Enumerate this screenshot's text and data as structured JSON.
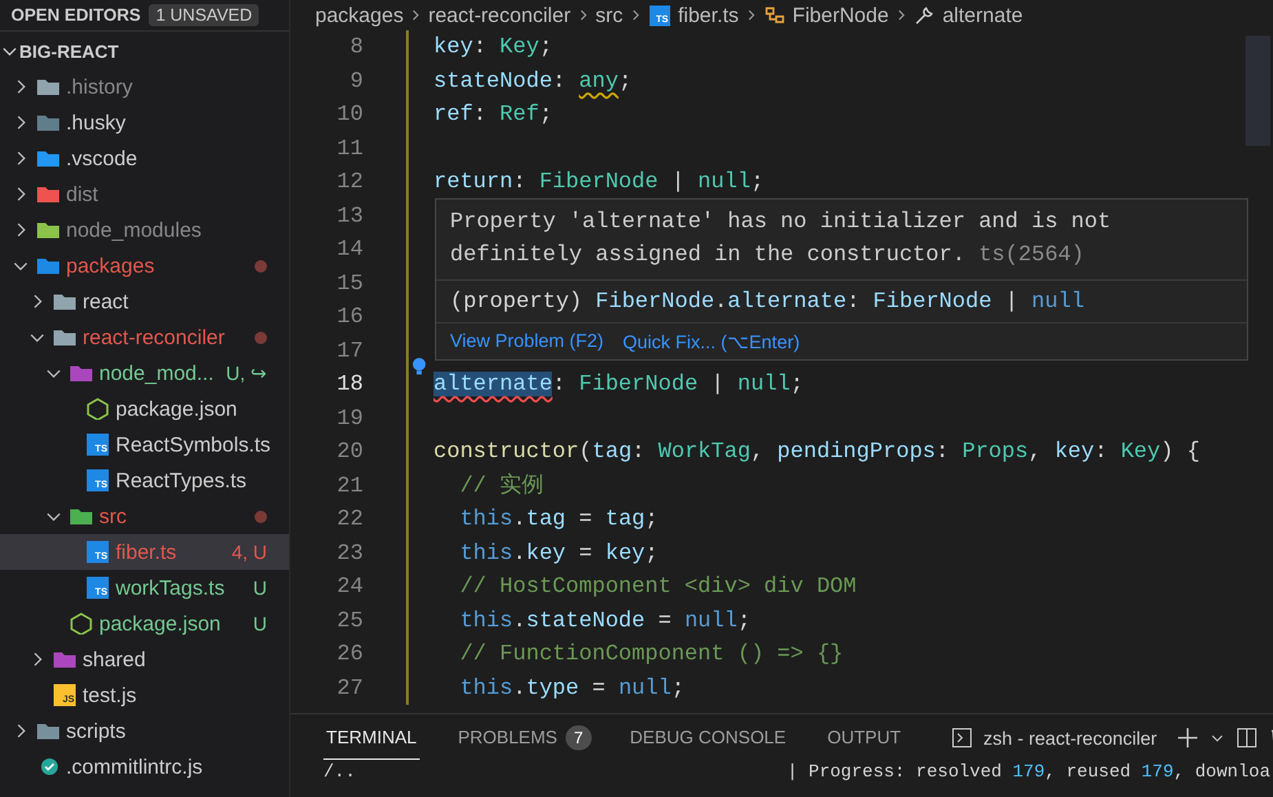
{
  "sidebar": {
    "open_editors": "OPEN EDITORS",
    "unsaved_badge": "1 UNSAVED",
    "project": "BIG-REACT",
    "tree": [
      {
        "name": ".history",
        "kind": "folder",
        "color": "#90a4ae",
        "dimmed": true,
        "modified": false,
        "untracked": false,
        "expanded": false,
        "selected": false
      },
      {
        "name": ".husky",
        "kind": "folder",
        "color": "#607d8b",
        "dimmed": false,
        "modified": false,
        "untracked": false,
        "expanded": false,
        "selected": false
      },
      {
        "name": ".vscode",
        "kind": "folder",
        "color": "#2196f3",
        "dimmed": false,
        "modified": false,
        "untracked": false,
        "expanded": false,
        "selected": false
      },
      {
        "name": "dist",
        "kind": "folder",
        "color": "#ef5350",
        "dimmed": true,
        "modified": false,
        "untracked": false,
        "expanded": false,
        "selected": false
      },
      {
        "name": "node_modules",
        "kind": "folder",
        "color": "#8bc34a",
        "dimmed": true,
        "modified": false,
        "untracked": false,
        "expanded": false,
        "selected": false
      },
      {
        "name": "packages",
        "kind": "folder",
        "color": "#1e88e5",
        "dimmed": false,
        "modified": true,
        "untracked": false,
        "expanded": true,
        "selected": false,
        "children": [
          {
            "name": "react",
            "kind": "folder",
            "color": "#90a4ae",
            "dimmed": false,
            "modified": false,
            "untracked": false,
            "expanded": false,
            "selected": false
          },
          {
            "name": "react-reconciler",
            "kind": "folder",
            "color": "#90a4ae",
            "dimmed": false,
            "modified": true,
            "untracked": false,
            "expanded": true,
            "selected": false,
            "children": [
              {
                "name": "node_mod...",
                "kind": "folder",
                "color": "#ab47bc",
                "dimmed": false,
                "modified": false,
                "untracked": true,
                "expanded": true,
                "selected": false,
                "status": "U, ↪",
                "children": [
                  {
                    "name": "package.json",
                    "kind": "json",
                    "dimmed": false,
                    "modified": false,
                    "untracked": false,
                    "selected": false
                  },
                  {
                    "name": "ReactSymbols.ts",
                    "kind": "ts",
                    "icon_text": "TS",
                    "dimmed": false,
                    "modified": false,
                    "untracked": false,
                    "selected": false
                  },
                  {
                    "name": "ReactTypes.ts",
                    "kind": "ts",
                    "icon_text": "TS",
                    "dimmed": false,
                    "modified": false,
                    "untracked": false,
                    "selected": false
                  }
                ]
              },
              {
                "name": "src",
                "kind": "folder",
                "color": "#4caf50",
                "dimmed": false,
                "modified": true,
                "untracked": false,
                "expanded": true,
                "selected": false,
                "children": [
                  {
                    "name": "fiber.ts",
                    "kind": "ts",
                    "icon_text": "TS",
                    "dimmed": false,
                    "modified": true,
                    "untracked": false,
                    "selected": true,
                    "status": "4, U"
                  },
                  {
                    "name": "workTags.ts",
                    "kind": "ts",
                    "icon_text": "TS",
                    "dimmed": false,
                    "modified": false,
                    "untracked": true,
                    "selected": false,
                    "status": "U"
                  }
                ]
              },
              {
                "name": "package.json",
                "kind": "json",
                "dimmed": false,
                "modified": false,
                "untracked": true,
                "selected": false,
                "status": "U"
              }
            ]
          },
          {
            "name": "shared",
            "kind": "folder",
            "color": "#ab47bc",
            "dimmed": false,
            "modified": false,
            "untracked": false,
            "expanded": false,
            "selected": false
          },
          {
            "name": "test.js",
            "kind": "js",
            "icon_text": "JS",
            "dimmed": false,
            "modified": false,
            "untracked": false,
            "selected": false
          }
        ]
      },
      {
        "name": "scripts",
        "kind": "folder",
        "color": "#78909c",
        "dimmed": false,
        "modified": false,
        "untracked": false,
        "expanded": false,
        "selected": false
      },
      {
        "name": ".commitlintrc.js",
        "kind": "config",
        "dimmed": false,
        "modified": false,
        "untracked": false,
        "selected": false
      }
    ]
  },
  "breadcrumb": [
    {
      "label": "packages",
      "kind": "plain"
    },
    {
      "label": "react-reconciler",
      "kind": "plain"
    },
    {
      "label": "src",
      "kind": "plain"
    },
    {
      "label": "fiber.ts",
      "kind": "ts",
      "icon_text": "TS"
    },
    {
      "label": "FiberNode",
      "kind": "class"
    },
    {
      "label": "alternate",
      "kind": "property"
    }
  ],
  "code": [
    {
      "num": "8",
      "current": false,
      "tokens": [
        {
          "text": "key",
          "kind": "prop"
        },
        {
          "text": ": ",
          "kind": "punct"
        },
        {
          "text": "Key",
          "kind": "type"
        },
        {
          "text": ";",
          "kind": "punct"
        }
      ]
    },
    {
      "num": "9",
      "current": false,
      "tokens": [
        {
          "text": "stateNode",
          "kind": "prop"
        },
        {
          "text": ": ",
          "kind": "punct"
        },
        {
          "text": "any",
          "kind": "warning"
        },
        {
          "text": ";",
          "kind": "punct"
        }
      ]
    },
    {
      "num": "10",
      "current": false,
      "tokens": [
        {
          "text": "ref",
          "kind": "prop"
        },
        {
          "text": ": ",
          "kind": "punct"
        },
        {
          "text": "Ref",
          "kind": "type"
        },
        {
          "text": ";",
          "kind": "punct"
        }
      ]
    },
    {
      "num": "11",
      "current": false
    },
    {
      "num": "12",
      "current": false,
      "tokens": [
        {
          "text": "return",
          "kind": "prop"
        },
        {
          "text": ": ",
          "kind": "punct"
        },
        {
          "text": "FiberNode",
          "kind": "type"
        },
        {
          "text": " | ",
          "kind": "punct"
        },
        {
          "text": "null",
          "kind": "type"
        },
        {
          "text": ";",
          "kind": "punct"
        }
      ]
    },
    {
      "num": "13",
      "current": false
    },
    {
      "num": "14",
      "current": false
    },
    {
      "num": "15",
      "current": false
    },
    {
      "num": "16",
      "current": false
    },
    {
      "num": "17",
      "current": false
    },
    {
      "num": "18",
      "current": true,
      "tokens": [
        {
          "text": "alternate",
          "kind": "error"
        },
        {
          "text": ": ",
          "kind": "punct"
        },
        {
          "text": "FiberNode",
          "kind": "type"
        },
        {
          "text": " | ",
          "kind": "punct"
        },
        {
          "text": "null",
          "kind": "type"
        },
        {
          "text": ";",
          "kind": "punct"
        }
      ]
    },
    {
      "num": "19",
      "current": false
    },
    {
      "num": "20",
      "current": false,
      "tokens": [
        {
          "text": "constructor",
          "kind": "func"
        },
        {
          "text": "(",
          "kind": "punct"
        },
        {
          "text": "tag",
          "kind": "prop"
        },
        {
          "text": ": ",
          "kind": "punct"
        },
        {
          "text": "WorkTag",
          "kind": "type"
        },
        {
          "text": ", ",
          "kind": "punct"
        },
        {
          "text": "pendingProps",
          "kind": "prop"
        },
        {
          "text": ": ",
          "kind": "punct"
        },
        {
          "text": "Props",
          "kind": "type"
        },
        {
          "text": ", ",
          "kind": "punct"
        },
        {
          "text": "key",
          "kind": "prop"
        },
        {
          "text": ": ",
          "kind": "punct"
        },
        {
          "text": "Key",
          "kind": "type"
        },
        {
          "text": ") {",
          "kind": "punct"
        }
      ]
    },
    {
      "num": "21",
      "current": false,
      "tokens": [
        {
          "text": "  // 实例",
          "kind": "comment"
        }
      ]
    },
    {
      "num": "22",
      "current": false,
      "tokens": [
        {
          "text": "  this",
          "kind": "keyword"
        },
        {
          "text": ".",
          "kind": "punct"
        },
        {
          "text": "tag",
          "kind": "prop"
        },
        {
          "text": " = ",
          "kind": "punct"
        },
        {
          "text": "tag",
          "kind": "prop"
        },
        {
          "text": ";",
          "kind": "punct"
        }
      ]
    },
    {
      "num": "23",
      "current": false,
      "tokens": [
        {
          "text": "  this",
          "kind": "keyword"
        },
        {
          "text": ".",
          "kind": "punct"
        },
        {
          "text": "key",
          "kind": "prop"
        },
        {
          "text": " = ",
          "kind": "punct"
        },
        {
          "text": "key",
          "kind": "prop"
        },
        {
          "text": ";",
          "kind": "punct"
        }
      ]
    },
    {
      "num": "24",
      "current": false,
      "tokens": [
        {
          "text": "  // HostComponent <div> div DOM",
          "kind": "comment"
        }
      ]
    },
    {
      "num": "25",
      "current": false,
      "tokens": [
        {
          "text": "  this",
          "kind": "keyword"
        },
        {
          "text": ".",
          "kind": "punct"
        },
        {
          "text": "stateNode",
          "kind": "prop"
        },
        {
          "text": " = ",
          "kind": "punct"
        },
        {
          "text": "null",
          "kind": "keyword"
        },
        {
          "text": ";",
          "kind": "punct"
        }
      ]
    },
    {
      "num": "26",
      "current": false,
      "tokens": [
        {
          "text": "  // FunctionComponent () => {}",
          "kind": "comment"
        }
      ]
    },
    {
      "num": "27",
      "current": false,
      "tokens": [
        {
          "text": "  this",
          "kind": "keyword"
        },
        {
          "text": ".",
          "kind": "punct"
        },
        {
          "text": "type",
          "kind": "prop"
        },
        {
          "text": " = ",
          "kind": "punct"
        },
        {
          "text": "null",
          "kind": "keyword"
        },
        {
          "text": ";",
          "kind": "punct"
        }
      ]
    }
  ],
  "hover": {
    "message": "Property 'alternate' has no initializer and is not definitely assigned in the constructor.",
    "code": "ts(2564)",
    "signature": [
      {
        "text": "(property) ",
        "kind": "punct"
      },
      {
        "text": "FiberNode",
        "kind": "light"
      },
      {
        "text": ".",
        "kind": "punct"
      },
      {
        "text": "alternate",
        "kind": "prop"
      },
      {
        "text": ": ",
        "kind": "punct"
      },
      {
        "text": "FiberNode",
        "kind": "light"
      },
      {
        "text": " | ",
        "kind": "punct"
      },
      {
        "text": "null",
        "kind": "keyword"
      }
    ],
    "actions": [
      "View Problem (F2)",
      "Quick Fix... (⌥Enter)"
    ]
  },
  "panel": {
    "tabs": [
      {
        "label": "TERMINAL",
        "selected": true
      },
      {
        "label": "PROBLEMS",
        "selected": false,
        "badge": "7"
      },
      {
        "label": "DEBUG CONSOLE",
        "selected": false
      },
      {
        "label": "OUTPUT",
        "selected": false
      }
    ],
    "terminal_name": "zsh - react-reconciler",
    "lines": [
      [
        {
          "text": "/..",
          "kind": "plain"
        }
      ],
      [
        {
          "text": "| Progress: resolved ",
          "kind": "plain"
        },
        {
          "text": "179",
          "kind": "num"
        },
        {
          "text": ", reused ",
          "kind": "plain"
        },
        {
          "text": "179",
          "kind": "num"
        },
        {
          "text": ", downloa",
          "kind": "plain"
        }
      ]
    ]
  }
}
